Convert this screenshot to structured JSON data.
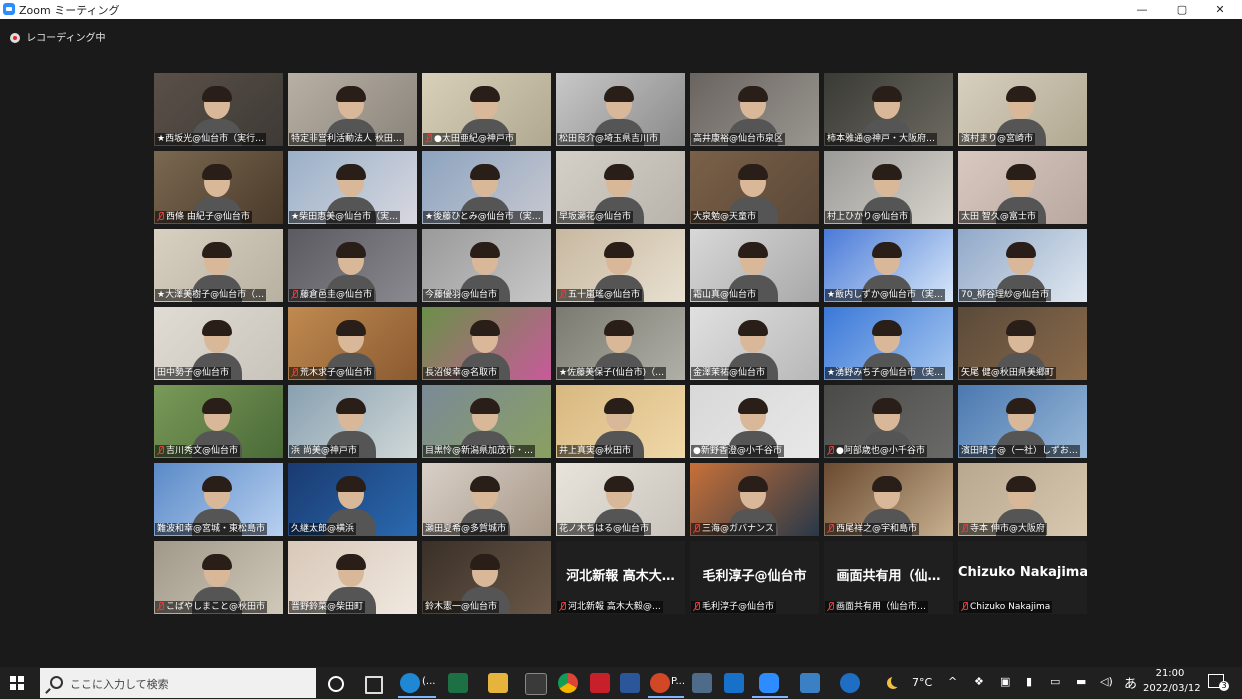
{
  "window": {
    "title": "Zoom ミーティング",
    "controls": [
      "—",
      "▢",
      "✕"
    ]
  },
  "recording": {
    "label": "レコーディング中"
  },
  "participants": [
    {
      "name": "★西坂光@仙台市（実行…",
      "muted": false
    },
    {
      "name": "特定非営利活動法人 秋田…",
      "muted": false
    },
    {
      "name": "●太田亜紀@神戸市",
      "muted": true
    },
    {
      "name": "松田良介@埼玉県吉川市",
      "muted": false
    },
    {
      "name": "高井康裕@仙台市泉区",
      "muted": false
    },
    {
      "name": "柿本雅通@神戸・大阪府…",
      "muted": false
    },
    {
      "name": "濱村まり@宮崎市",
      "muted": false
    },
    {
      "name": "西條 由紀子@仙台市",
      "muted": true
    },
    {
      "name": "★柴田恵美@仙台市（実…",
      "muted": false
    },
    {
      "name": "★後藤ひとみ@仙台市（実…",
      "muted": false
    },
    {
      "name": "早坂瀬花@仙台市",
      "muted": false
    },
    {
      "name": "大泉勉@天童市",
      "muted": false
    },
    {
      "name": "村上ひかり@仙台市",
      "muted": false
    },
    {
      "name": "太田 智久@富士市",
      "muted": false
    },
    {
      "name": "★大澤美樹子@仙台市（…",
      "muted": false
    },
    {
      "name": "藤倉邑圭@仙台市",
      "muted": true
    },
    {
      "name": "今藤優羽@仙台市",
      "muted": false
    },
    {
      "name": "五十嵐瑤@仙台市",
      "muted": true
    },
    {
      "name": "霜山真@仙台市",
      "muted": false
    },
    {
      "name": "★飯内しずか@仙台市（実…",
      "muted": false
    },
    {
      "name": "70_柳谷理紗@仙台市",
      "muted": false
    },
    {
      "name": "田中勢子@仙台市",
      "muted": false
    },
    {
      "name": "荒木求子@仙台市",
      "muted": true
    },
    {
      "name": "長沼俊幸@名取市",
      "muted": false
    },
    {
      "name": "★佐藤美保子(仙台市)（…",
      "muted": false
    },
    {
      "name": "金澤茉祐@仙台市",
      "muted": false
    },
    {
      "name": "★湧野みち子@仙台市（実…",
      "muted": false
    },
    {
      "name": "矢尾 健@秋田県美郷町",
      "muted": false
    },
    {
      "name": "吉川秀文@仙台市",
      "muted": true
    },
    {
      "name": "浜 尚美@神戸市",
      "muted": false
    },
    {
      "name": "目黒怜@新潟県加茂市・…",
      "muted": false
    },
    {
      "name": "井上真実@秋田市",
      "muted": false
    },
    {
      "name": "●新野香澄@小千谷市",
      "muted": false
    },
    {
      "name": "●阿部歳也@小千谷市",
      "muted": true
    },
    {
      "name": "濱田晴子@（一社）しずお…",
      "muted": false
    },
    {
      "name": "難波和幸@宮城・東松島市",
      "muted": false
    },
    {
      "name": "久継太郎@横浜",
      "muted": false
    },
    {
      "name": "瀬田夏希@多賀城市",
      "muted": false
    },
    {
      "name": "花ノ木ちはる@仙台市",
      "muted": false
    },
    {
      "name": "三海@ガバナンス",
      "muted": true
    },
    {
      "name": "西尾祥之@宇和島市",
      "muted": true
    },
    {
      "name": "寺本 伸市@大阪府",
      "muted": true
    },
    {
      "name": "こばやしまこと@秋田市",
      "muted": true
    },
    {
      "name": "晋野鈴菜@柴田町",
      "muted": false
    },
    {
      "name": "鈴木憲一@仙台市",
      "muted": false
    },
    {
      "name": "河北新報 高木大毅@…",
      "muted": true,
      "big": "河北新報 高木大…"
    },
    {
      "name": "毛利淳子@仙台市",
      "muted": true,
      "big": "毛利淳子@仙台市"
    },
    {
      "name": "画面共有用（仙台市…",
      "muted": true,
      "big": "画面共有用（仙…"
    },
    {
      "name": "Chizuko Nakajima",
      "muted": true,
      "big": "Chizuko Nakajima"
    }
  ],
  "taskbar": {
    "search_placeholder": "ここに入力して検索",
    "edge_label": "(...",
    "ppt_label": "P...",
    "weather": "7°C",
    "ime": "あ",
    "time": "21:00",
    "date": "2022/03/12",
    "notification_count": "3"
  }
}
